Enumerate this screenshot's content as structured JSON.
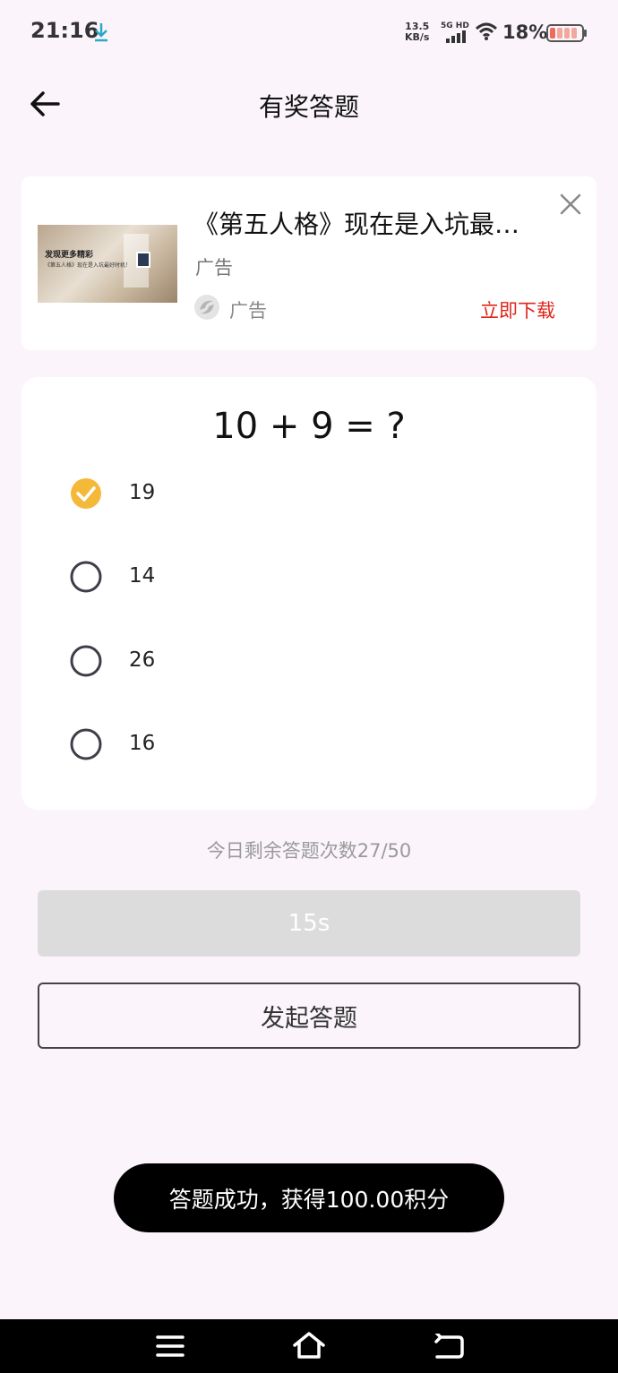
{
  "status_bar": {
    "time": "21:16",
    "net_speed_value": "13.5",
    "net_speed_unit": "KB/s",
    "network_label": "5G HD",
    "battery": "18%"
  },
  "header": {
    "title": "有奖答题"
  },
  "ad": {
    "thumb_headline": "发现更多精彩",
    "thumb_caption": "《第五人格》现在是入坑最好时机！",
    "title": "《第五人格》现在是入坑最…",
    "subtitle": "广告",
    "brand": "广告",
    "download_label": "立即下载"
  },
  "quiz": {
    "question": "10 + 9 = ?",
    "options": [
      {
        "label": "19",
        "selected": true
      },
      {
        "label": "14",
        "selected": false
      },
      {
        "label": "26",
        "selected": false
      },
      {
        "label": "16",
        "selected": false
      }
    ]
  },
  "remaining_text": "今日剩余答题次数27/50",
  "timer_label": "15s",
  "initiate_label": "发起答题",
  "toast": "答题成功，获得100.00积分",
  "colors": {
    "accent": "#f5b93a",
    "ad_download": "#e1251b",
    "background": "#fbf5fb"
  }
}
